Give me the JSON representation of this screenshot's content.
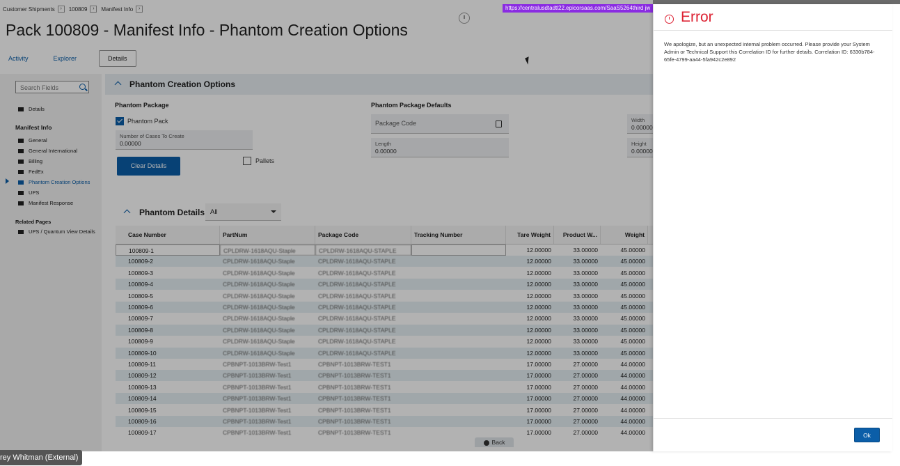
{
  "breadcrumb": [
    "Customer Shipments",
    "100809",
    "Manifest Info"
  ],
  "url": "https://centralusdtadtl22.epicorsaas.com/SaaS5264third  jw",
  "title": "Pack 100809 - Manifest Info - Phantom Creation Options",
  "tabs": [
    "Activity",
    "Explorer",
    "Details"
  ],
  "sidebar": {
    "search_placeholder": "Search Fields",
    "details_label": "Details",
    "manifest_head": "Manifest Info",
    "items": [
      "General",
      "General International",
      "Billing",
      "FedEx",
      "Phantom Creation Options",
      "UPS",
      "Manifest Response"
    ],
    "related_head": "Related Pages",
    "related_items": [
      "UPS / Quantum View Details"
    ]
  },
  "section": {
    "title": "Phantom Creation Options",
    "phantom_package_head": "Phantom Package",
    "phantom_pack_label": "Phantom Pack",
    "phantom_pack_checked": true,
    "cases_label": "Number of Cases To Create",
    "cases_value": "0.00000",
    "pallets_label": "Pallets",
    "clear_button": "Clear Details",
    "defaults_head": "Phantom Package Defaults",
    "package_code_placeholder": "Package Code",
    "length_label": "Length",
    "length_value": "0.00000",
    "width_label": "Width",
    "width_value": "0.00000",
    "height_label": "Height",
    "height_value": "0.00000"
  },
  "details": {
    "title": "Phantom Details",
    "filter_value": "All",
    "columns": [
      "Case Number",
      "PartNum",
      "Package Code",
      "Tracking Number",
      "Tare Weight",
      "Product W...",
      "Weight"
    ],
    "rows": [
      [
        "100809-1",
        "CPLDRW-1618AQU-Staple",
        "CPLDRW-1618AQU-STAPLE",
        "",
        "12.00000",
        "33.00000",
        "45.00000"
      ],
      [
        "100809-2",
        "CPLDRW-1618AQU-Staple",
        "CPLDRW-1618AQU-STAPLE",
        "",
        "12.00000",
        "33.00000",
        "45.00000"
      ],
      [
        "100809-3",
        "CPLDRW-1618AQU-Staple",
        "CPLDRW-1618AQU-STAPLE",
        "",
        "12.00000",
        "33.00000",
        "45.00000"
      ],
      [
        "100809-4",
        "CPLDRW-1618AQU-Staple",
        "CPLDRW-1618AQU-STAPLE",
        "",
        "12.00000",
        "33.00000",
        "45.00000"
      ],
      [
        "100809-5",
        "CPLDRW-1618AQU-Staple",
        "CPLDRW-1618AQU-STAPLE",
        "",
        "12.00000",
        "33.00000",
        "45.00000"
      ],
      [
        "100809-6",
        "CPLDRW-1618AQU-Staple",
        "CPLDRW-1618AQU-STAPLE",
        "",
        "12.00000",
        "33.00000",
        "45.00000"
      ],
      [
        "100809-7",
        "CPLDRW-1618AQU-Staple",
        "CPLDRW-1618AQU-STAPLE",
        "",
        "12.00000",
        "33.00000",
        "45.00000"
      ],
      [
        "100809-8",
        "CPLDRW-1618AQU-Staple",
        "CPLDRW-1618AQU-STAPLE",
        "",
        "12.00000",
        "33.00000",
        "45.00000"
      ],
      [
        "100809-9",
        "CPLDRW-1618AQU-Staple",
        "CPLDRW-1618AQU-STAPLE",
        "",
        "12.00000",
        "33.00000",
        "45.00000"
      ],
      [
        "100809-10",
        "CPLDRW-1618AQU-Staple",
        "CPLDRW-1618AQU-STAPLE",
        "",
        "12.00000",
        "33.00000",
        "45.00000"
      ],
      [
        "100809-11",
        "CPBNPT-1013BRW-Test1",
        "CPBNPT-1013BRW-TEST1",
        "",
        "17.00000",
        "27.00000",
        "44.00000"
      ],
      [
        "100809-12",
        "CPBNPT-1013BRW-Test1",
        "CPBNPT-1013BRW-TEST1",
        "",
        "17.00000",
        "27.00000",
        "44.00000"
      ],
      [
        "100809-13",
        "CPBNPT-1013BRW-Test1",
        "CPBNPT-1013BRW-TEST1",
        "",
        "17.00000",
        "27.00000",
        "44.00000"
      ],
      [
        "100809-14",
        "CPBNPT-1013BRW-Test1",
        "CPBNPT-1013BRW-TEST1",
        "",
        "17.00000",
        "27.00000",
        "44.00000"
      ],
      [
        "100809-15",
        "CPBNPT-1013BRW-Test1",
        "CPBNPT-1013BRW-TEST1",
        "",
        "17.00000",
        "27.00000",
        "44.00000"
      ],
      [
        "100809-16",
        "CPBNPT-1013BRW-Test1",
        "CPBNPT-1013BRW-TEST1",
        "",
        "17.00000",
        "27.00000",
        "44.00000"
      ],
      [
        "100809-17",
        "CPBNPT-1013BRW-Test1",
        "CPBNPT-1013BRW-TEST1",
        "",
        "17.00000",
        "27.00000",
        "44.00000"
      ]
    ],
    "back_label": "Back"
  },
  "error": {
    "title": "Error",
    "message": "We apologize, but an unexpected internal problem occurred. Please provide your System Admin or Technical Support this Correlation ID for further details. Correlation ID: 6330b784-65fe-4799-aa44-5fa942c2e892",
    "ok_label": "Ok"
  },
  "user_tag": "rey Whitman (External)",
  "colors": {
    "accent": "#0b5ea8",
    "error": "#dd2233",
    "url_bar": "#8a2be2"
  }
}
